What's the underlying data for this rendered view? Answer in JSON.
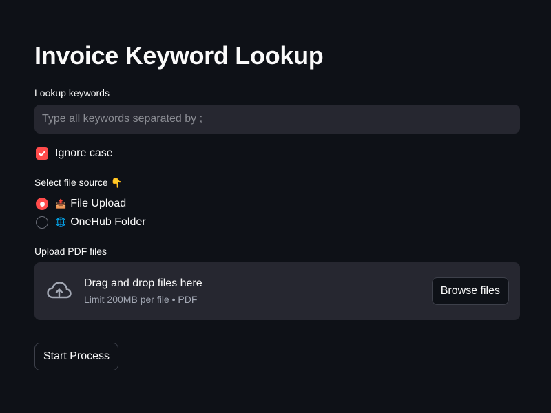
{
  "page": {
    "title": "Invoice Keyword Lookup"
  },
  "keywords": {
    "label": "Lookup keywords",
    "placeholder": "Type all keywords separated by ;",
    "value": ""
  },
  "ignore_case": {
    "label": "Ignore case",
    "checked": true
  },
  "file_source": {
    "label": "Select file source 👇",
    "options": [
      {
        "emoji": "📤",
        "label": "File Upload",
        "selected": true
      },
      {
        "emoji": "🌐",
        "label": "OneHub Folder",
        "selected": false
      }
    ]
  },
  "uploader": {
    "label": "Upload PDF files",
    "drag_text": "Drag and drop files here",
    "limit_text": "Limit 200MB per file • PDF",
    "browse_label": "Browse files",
    "icon": "cloud-upload-icon"
  },
  "actions": {
    "start_label": "Start Process"
  },
  "colors": {
    "background": "#0e1117",
    "widget_bg": "#262730",
    "accent": "#ff4b4b",
    "text": "#fafafa",
    "muted_text": "#a3a8b4"
  }
}
